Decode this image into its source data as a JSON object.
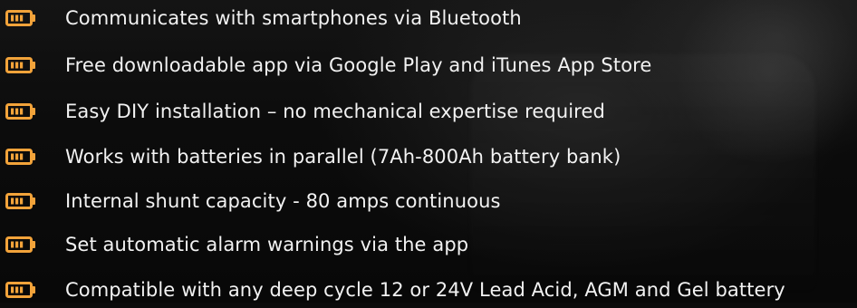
{
  "features": {
    "items": [
      {
        "icon": "battery-icon",
        "label": "Communicates with smartphones via Bluetooth"
      },
      {
        "icon": "battery-icon",
        "label": "Free downloadable app via Google Play and iTunes App Store"
      },
      {
        "icon": "battery-icon",
        "label": "Easy DIY installation – no mechanical expertise required"
      },
      {
        "icon": "battery-icon",
        "label": "Works with batteries in parallel (7Ah-800Ah battery bank)"
      },
      {
        "icon": "battery-icon",
        "label": "Internal shunt capacity - 80 amps continuous"
      },
      {
        "icon": "battery-icon",
        "label": "Set automatic alarm warnings via the app"
      },
      {
        "icon": "battery-icon",
        "label": "Compatible with any deep cycle 12 or 24V Lead Acid, AGM and Gel battery"
      }
    ]
  },
  "colors": {
    "accent": "#f2a33a",
    "text": "#f2f2f2",
    "background": "#0b0b0b"
  }
}
